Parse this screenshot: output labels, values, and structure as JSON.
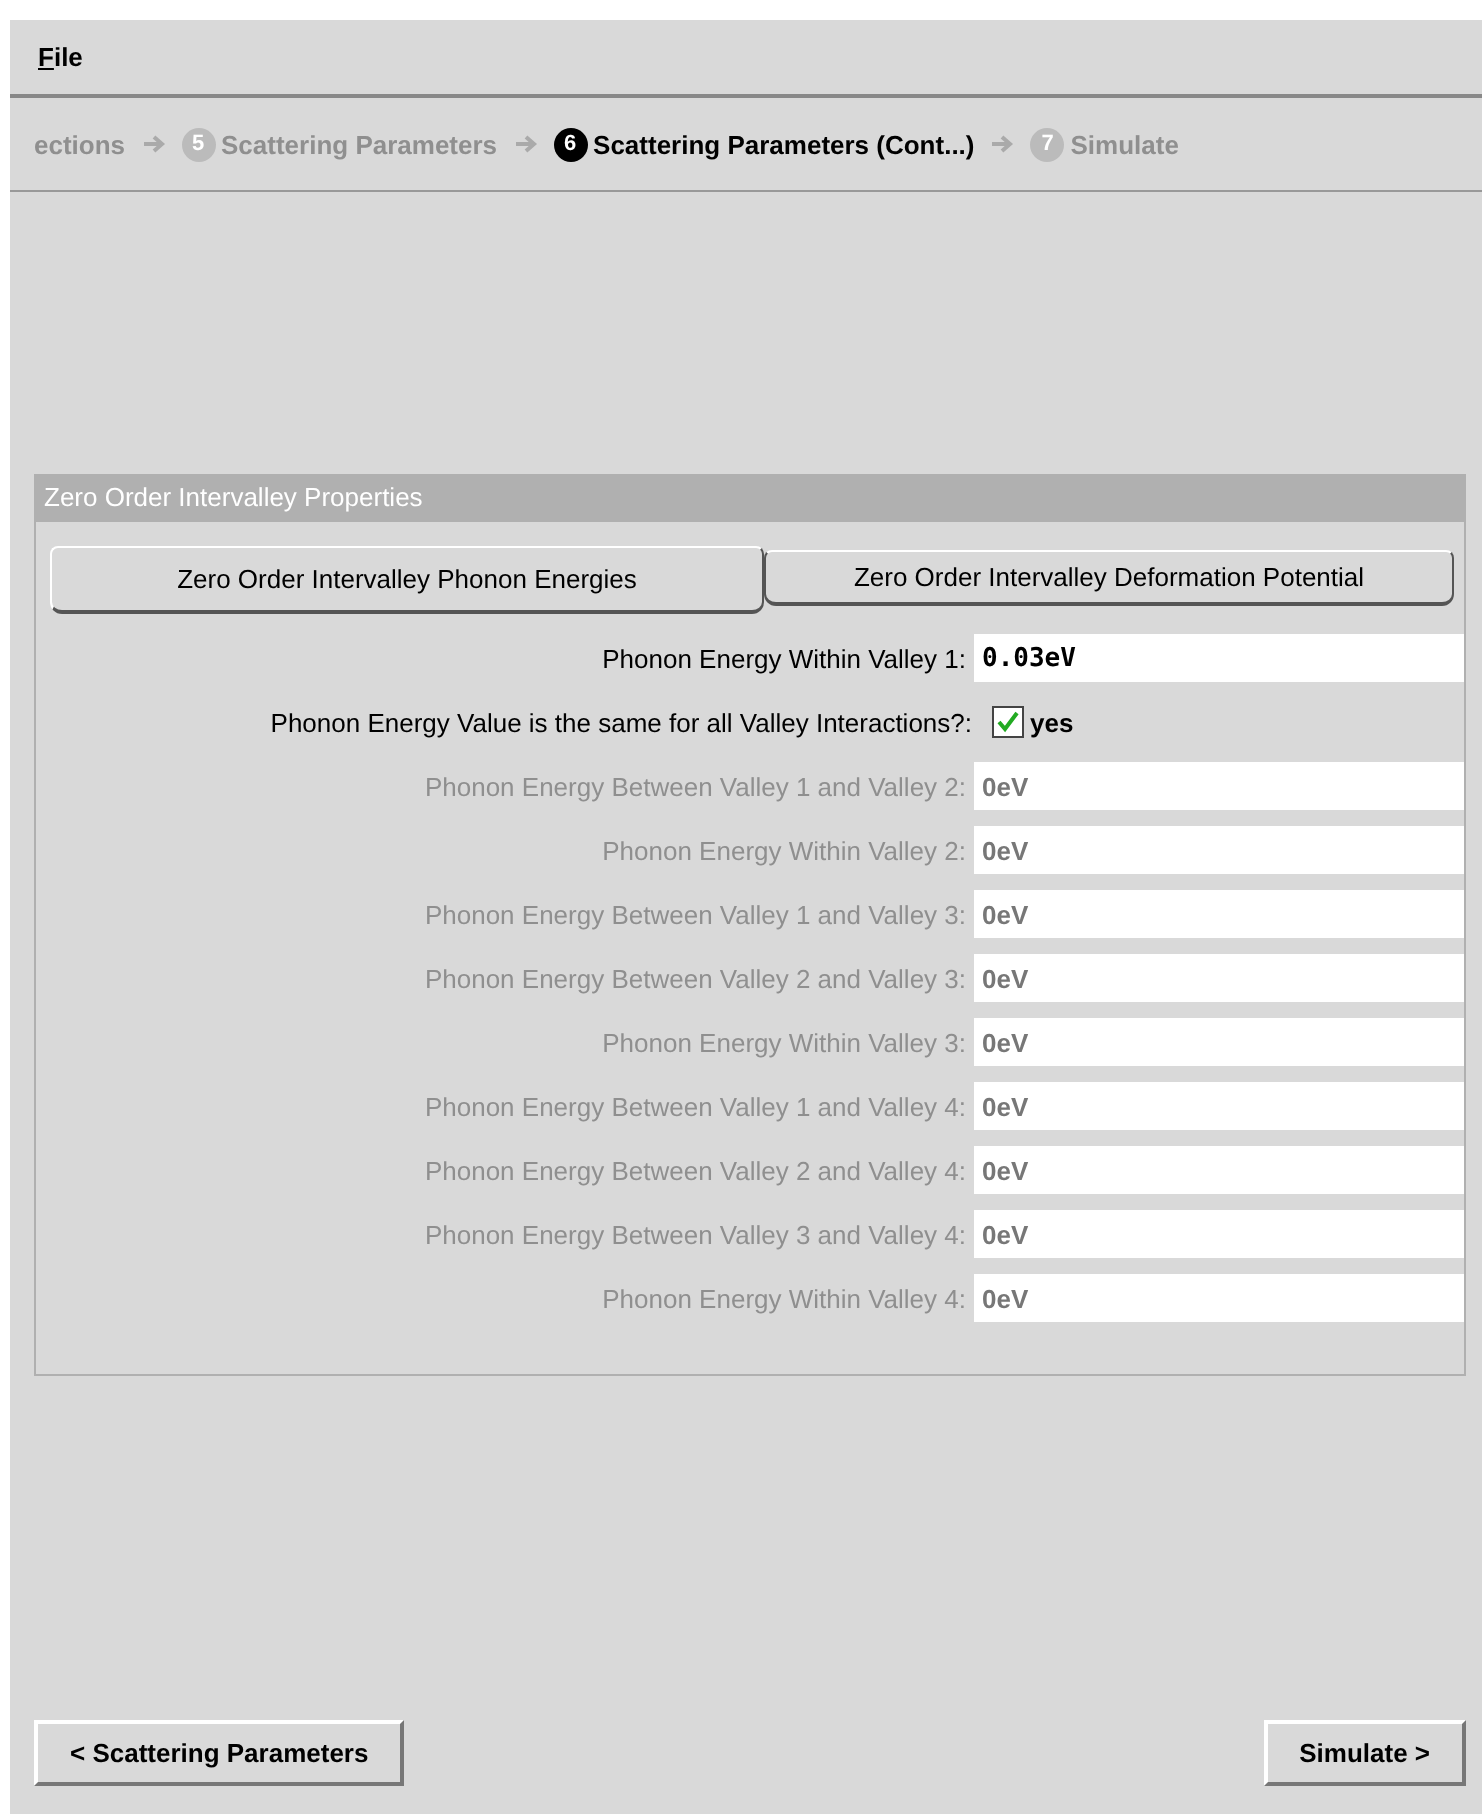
{
  "menu": [
    {
      "label": "File"
    }
  ],
  "breadcrumb": [
    {
      "label": "ections",
      "selected": false
    },
    {
      "number": "5",
      "label": "Scattering Parameters",
      "selected": false
    },
    {
      "number": "6",
      "label": "Scattering Parameters (Cont...)",
      "selected": true
    },
    {
      "number": "7",
      "label": "Simulate",
      "selected": false
    }
  ],
  "panel": {
    "title": "Zero Order Intervalley Properties",
    "tabs": [
      {
        "label": "Zero Order Intervalley Phonon Energies",
        "selected": true
      },
      {
        "label": "Zero Order Intervalley Deformation Potential",
        "selected": false
      }
    ],
    "rows": [
      {
        "kind": "field",
        "label": "Phonon Energy Within Valley 1:",
        "value": "0.03eV",
        "disabled": false
      },
      {
        "kind": "checkbox",
        "label": "Phonon Energy Value is the same for all Valley Interactions?:",
        "value": "yes",
        "checked": true
      },
      {
        "kind": "field",
        "label": "Phonon Energy Between Valley 1 and Valley 2:",
        "value": "0eV",
        "disabled": true
      },
      {
        "kind": "field",
        "label": "Phonon Energy Within Valley 2:",
        "value": "0eV",
        "disabled": true
      },
      {
        "kind": "field",
        "label": "Phonon Energy Between Valley 1 and Valley 3:",
        "value": "0eV",
        "disabled": true
      },
      {
        "kind": "field",
        "label": "Phonon Energy Between Valley 2 and Valley 3:",
        "value": "0eV",
        "disabled": true
      },
      {
        "kind": "field",
        "label": "Phonon Energy Within Valley 3:",
        "value": "0eV",
        "disabled": true
      },
      {
        "kind": "field",
        "label": "Phonon Energy Between Valley 1 and Valley 4:",
        "value": "0eV",
        "disabled": true
      },
      {
        "kind": "field",
        "label": "Phonon Energy Between Valley 2 and Valley 4:",
        "value": "0eV",
        "disabled": true
      },
      {
        "kind": "field",
        "label": "Phonon Energy Between Valley 3 and Valley 4:",
        "value": "0eV",
        "disabled": true
      },
      {
        "kind": "field",
        "label": "Phonon Energy Within Valley 4:",
        "value": "0eV",
        "disabled": true
      }
    ]
  },
  "buttons": [
    {
      "label": "< Scattering Parameters"
    },
    {
      "label": "Simulate >"
    }
  ]
}
